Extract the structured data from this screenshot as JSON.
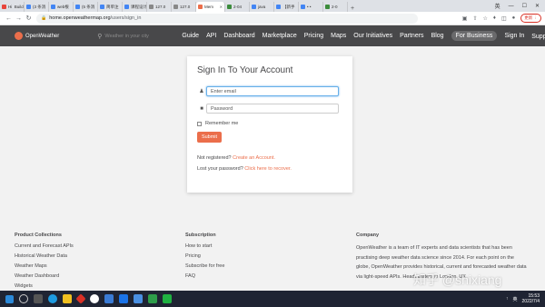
{
  "browser": {
    "tabs": [
      {
        "label": "Hi  Build",
        "color": "#e8453c"
      },
      {
        "label": "(3 条消",
        "color": "#4285f4"
      },
      {
        "label": "web根",
        "color": "#4285f4"
      },
      {
        "label": "(5 条消",
        "color": "#4285f4"
      },
      {
        "label": "简单注",
        "color": "#4285f4"
      },
      {
        "label": "课程设计",
        "color": "#4285f4"
      },
      {
        "label": "127.0",
        "color": "#888888"
      },
      {
        "label": "127.0",
        "color": "#888888"
      },
      {
        "label": "Mem",
        "color": "#eb6e4b",
        "active": true
      },
      {
        "label": "2-04",
        "color": "#3c8c3c"
      },
      {
        "label": "java",
        "color": "#4285f4"
      },
      {
        "label": "【新手",
        "color": "#4285f4"
      },
      {
        "label": "• •",
        "color": "#4285f4"
      },
      {
        "label": "2-0",
        "color": "#3c8c3c"
      }
    ],
    "window_controls": [
      "英",
      "—",
      "☐",
      "✕"
    ],
    "url_host": "home.openweathermap.org",
    "url_path": "/users/sign_in",
    "update_label": "更新 ⋮"
  },
  "header": {
    "logo_text": "OpenWeather",
    "search_placeholder": "Weather in your city",
    "menu": [
      "Guide",
      "API",
      "Dashboard",
      "Marketplace",
      "Pricing",
      "Maps",
      "Our Initiatives",
      "Partners",
      "Blog",
      "For Business",
      "Sign In",
      "Support ▾"
    ]
  },
  "signin": {
    "title": "Sign In To Your Account",
    "email_placeholder": "Enter email",
    "password_placeholder": "Password",
    "remember_label": "Remember me",
    "submit_label": "Submit",
    "not_registered_text": "Not registered?",
    "create_account_link": "Create an Account.",
    "lost_password_text": "Lost your password?",
    "recover_link": "Click here to recover."
  },
  "footer": {
    "product_collections": {
      "heading": "Product Collections",
      "items": [
        "Current and Forecast APIs",
        "Historical Weather Data",
        "Weather Maps",
        "Weather Dashboard",
        "Widgets"
      ]
    },
    "subscription": {
      "heading": "Subscription",
      "items": [
        "How to start",
        "Pricing",
        "Subscribe for free",
        "FAQ"
      ]
    },
    "company": {
      "heading": "Company",
      "text": "OpenWeather is a team of IT experts and data scientists that has been practising deep weather data science since 2014. For each point on the globe, OpenWeather provides historical, current and forecasted weather data via light-speed APIs. Headquarters in London, UK."
    }
  },
  "taskbar": {
    "time": "15:53",
    "date": "2022/7/4",
    "tray": [
      "↑",
      "英"
    ]
  },
  "watermark": "知乎 @shixiang"
}
